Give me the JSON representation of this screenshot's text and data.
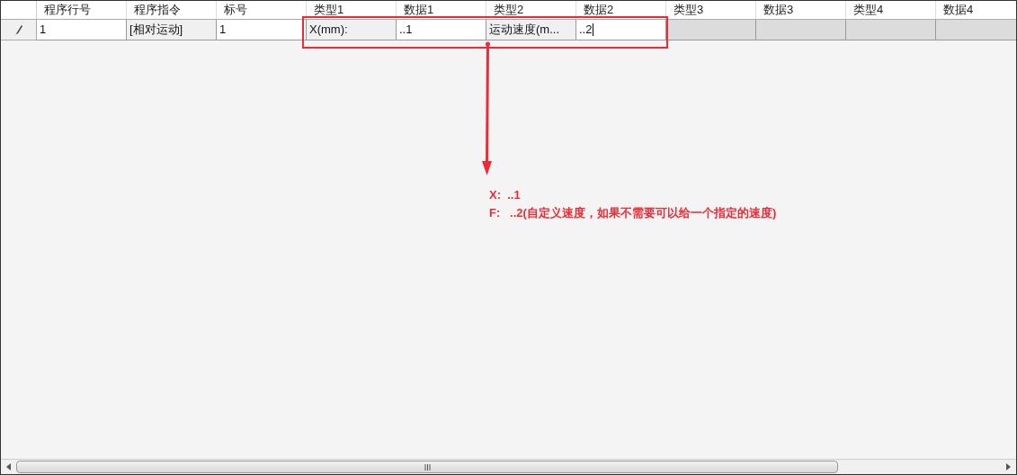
{
  "table": {
    "columns": [
      "程序行号",
      "程序指令",
      "标号",
      "类型1",
      "数据1",
      "类型2",
      "数据2",
      "类型3",
      "数据3",
      "类型4",
      "数据4"
    ],
    "rows": [
      {
        "editing": true,
        "cells": [
          {
            "kind": "editable",
            "text": "1",
            "editing": false
          },
          {
            "kind": "readonly",
            "text": "[相对运动]",
            "editing": false
          },
          {
            "kind": "editable",
            "text": "1",
            "editing": false
          },
          {
            "kind": "readonly",
            "text": "X(mm):",
            "editing": false
          },
          {
            "kind": "editable",
            "text": "..1",
            "editing": false
          },
          {
            "kind": "readonly",
            "text": "运动速度(m...",
            "editing": false
          },
          {
            "kind": "editable",
            "text": "..2",
            "editing": true
          },
          {
            "kind": "empty",
            "editing": false
          },
          {
            "kind": "empty",
            "editing": false
          },
          {
            "kind": "empty",
            "editing": false
          },
          {
            "kind": "empty",
            "editing": false
          }
        ]
      }
    ]
  },
  "annotation": {
    "lines": [
      "X:  ..1",
      "F:   ..2(自定义速度，如果不需要可以给一个指定的速度)"
    ]
  }
}
